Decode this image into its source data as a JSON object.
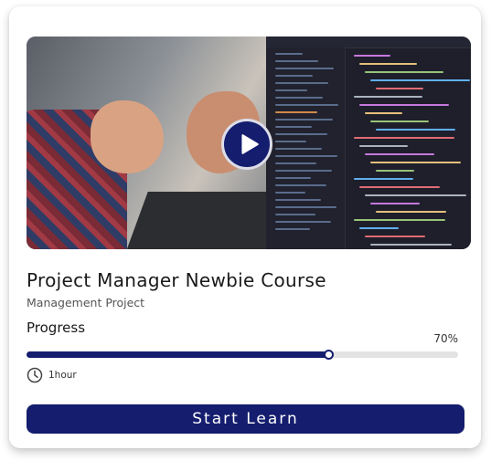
{
  "course": {
    "title": "Project Manager Newbie Course",
    "subtitle": "Management Project"
  },
  "progress": {
    "label": "Progress",
    "percent_label": "70%",
    "value": 0.7
  },
  "duration": {
    "label": "1hour",
    "icon": "clock-icon"
  },
  "video": {
    "play_icon": "play-icon"
  },
  "actions": {
    "start_label": "Start Learn"
  },
  "colors": {
    "accent": "#141d6e",
    "track": "#e3e3e3"
  }
}
